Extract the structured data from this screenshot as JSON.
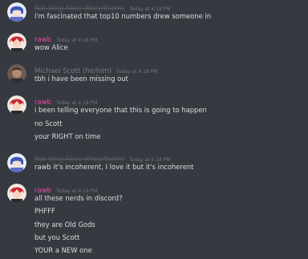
{
  "messages": [
    {
      "author": "Rat King Alice (they/them)",
      "author_color": "#5a5d63",
      "avatar": "alice-avatar",
      "timestamp": "Today at 4:18 PM",
      "lines": [
        "i'm fascinated that top10 numbers drew someone in"
      ]
    },
    {
      "author": "rawb",
      "author_color": "#e64ba9",
      "avatar": "rawb-avatar",
      "timestamp": "Today at 4:18 PM",
      "lines": [
        "wow Alice"
      ]
    },
    {
      "author": "Michael Scott (he/him)",
      "author_color": "#767a80",
      "avatar": "michael-avatar",
      "timestamp": "Today at 4:18 PM",
      "lines": [
        "tbh i have been missing out"
      ]
    },
    {
      "author": "rawb",
      "author_color": "#e64ba9",
      "avatar": "rawb-avatar",
      "timestamp": "Today at 4:18 PM",
      "lines": [
        "i been telling everyone that this is going to happen",
        "no Scott",
        "your RIGHT on time"
      ]
    },
    {
      "author": "Rat King Alice (they/them)",
      "author_color": "#5a5d63",
      "avatar": "alice-avatar",
      "timestamp": "Today at 4:18 PM",
      "lines": [
        "rawb it's incoherent, I love it but it's incoherent"
      ]
    },
    {
      "author": "rawb",
      "author_color": "#e64ba9",
      "avatar": "rawb-avatar",
      "timestamp": "Today at 4:19 PM",
      "lines": [
        "all these nerds in discord?",
        "PHFFF",
        "they are Old Gods",
        "but you Scott",
        "YOUR a NEW one"
      ]
    }
  ]
}
